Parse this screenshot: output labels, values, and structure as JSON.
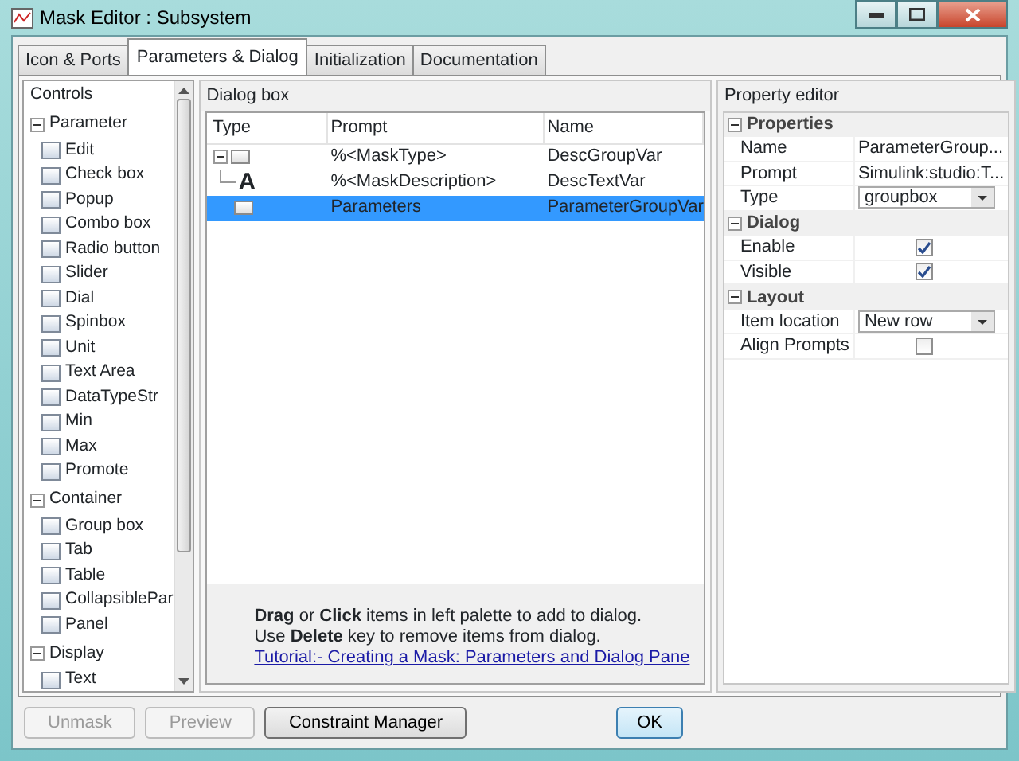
{
  "window": {
    "title": "Mask Editor : Subsystem"
  },
  "tabs": [
    {
      "label": "Icon & Ports",
      "selected": false
    },
    {
      "label": "Parameters & Dialog",
      "selected": true
    },
    {
      "label": "Initialization",
      "selected": false
    },
    {
      "label": "Documentation",
      "selected": false
    }
  ],
  "controls": {
    "title": "Controls",
    "groups": [
      {
        "label": "Parameter",
        "expanded": true,
        "items": [
          "Edit",
          "Check box",
          "Popup",
          "Combo box",
          "Radio button",
          "Slider",
          "Dial",
          "Spinbox",
          "Unit",
          "Text Area",
          "DataTypeStr",
          "Min",
          "Max",
          "Promote"
        ]
      },
      {
        "label": "Container",
        "expanded": true,
        "items": [
          "Group box",
          "Tab",
          "Table",
          "CollapsiblePar",
          "Panel"
        ]
      },
      {
        "label": "Display",
        "expanded": true,
        "items": [
          "Text"
        ]
      }
    ]
  },
  "dialog_box": {
    "title": "Dialog box",
    "columns": [
      "Type",
      "Prompt",
      "Name"
    ],
    "rows": [
      {
        "kind": "group",
        "prompt": "%<MaskType>",
        "name": "DescGroupVar",
        "expanded": true,
        "selected": false,
        "children": [
          {
            "kind": "text",
            "glyph": "A",
            "prompt": "%<MaskDescription>",
            "name": "DescTextVar",
            "selected": false
          }
        ]
      },
      {
        "kind": "group",
        "prompt": "Parameters",
        "name": "ParameterGroupVar",
        "selected": true
      }
    ],
    "hints": [
      "**Drag** or **Click** items in left palette to add to dialog.",
      "Use **Delete** key to remove items from dialog."
    ],
    "link": "Tutorial:- Creating a Mask: Parameters and Dialog Pane"
  },
  "property_editor": {
    "title": "Property editor",
    "sections": [
      {
        "label": "Properties",
        "expanded": true,
        "rows": [
          {
            "label": "Name",
            "kind": "text",
            "value": "ParameterGroup..."
          },
          {
            "label": "Prompt",
            "kind": "text",
            "value": "Simulink:studio:T..."
          },
          {
            "label": "Type",
            "kind": "dropdown",
            "value": "groupbox"
          }
        ]
      },
      {
        "label": "Dialog",
        "expanded": true,
        "rows": [
          {
            "label": "Enable",
            "kind": "checkbox",
            "checked": true
          },
          {
            "label": "Visible",
            "kind": "checkbox",
            "checked": true
          }
        ]
      },
      {
        "label": "Layout",
        "expanded": true,
        "rows": [
          {
            "label": "Item location",
            "kind": "dropdown",
            "value": "New row"
          },
          {
            "label": "Align Prompts",
            "kind": "checkbox",
            "checked": false
          }
        ]
      }
    ]
  },
  "buttons_left": [
    {
      "label": "Unmask",
      "disabled": true
    },
    {
      "label": "Preview",
      "disabled": true
    },
    {
      "label": "Constraint Manager",
      "disabled": false
    }
  ],
  "buttons_right": [
    {
      "label": "OK",
      "default": true
    }
  ]
}
